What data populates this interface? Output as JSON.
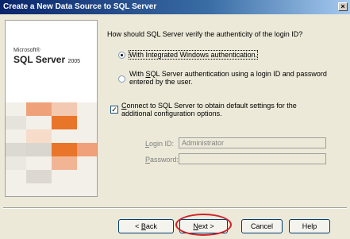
{
  "window": {
    "title": "Create a New Data Source to SQL Server",
    "close_glyph": "×"
  },
  "brand": {
    "microsoft": "Microsoft®",
    "product": "SQL Server",
    "year": "2005"
  },
  "question": "How should SQL Server verify the authenticity of the login ID?",
  "auth_options": [
    {
      "label": "With Integrated Windows authentication.",
      "selected": true
    },
    {
      "label_pre": "With ",
      "label_mnemonic": "S",
      "label_post": "QL Server authentication using a login ID and password",
      "label_line2": "entered by the user.",
      "selected": false
    }
  ],
  "connect_option": {
    "checked": true,
    "check_glyph": "✓",
    "label_mnemonic": "C",
    "label_post": "onnect to SQL Server to obtain default settings for the",
    "label_line2": "additional configuration options."
  },
  "login": {
    "label_mnemonic": "L",
    "label_post": "ogin ID:",
    "value": "Administrator",
    "enabled": false
  },
  "password": {
    "label_mnemonic": "P",
    "label_post": "assword:",
    "value": "",
    "enabled": false
  },
  "buttons": {
    "back": {
      "prefix": "< ",
      "mnemonic": "B",
      "rest": "ack"
    },
    "next": {
      "mnemonic": "N",
      "rest": "ext",
      "suffix": " >"
    },
    "cancel": "Cancel",
    "help": "Help"
  },
  "colors": {
    "title_start": "#0a246a",
    "highlight_ellipse": "#d0202a",
    "brand_orange": "#e8752a"
  }
}
